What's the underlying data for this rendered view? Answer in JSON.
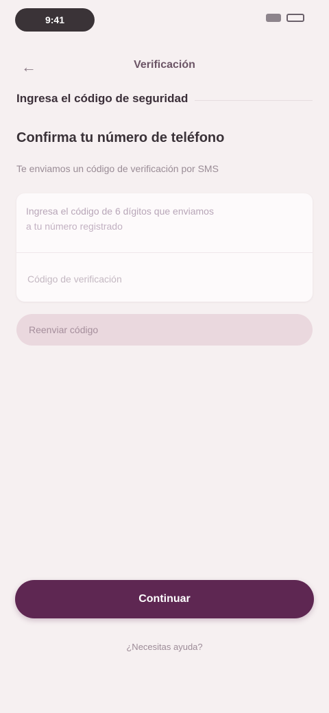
{
  "status_bar": {
    "time": "9:41"
  },
  "header": {
    "back_icon": "arrow-left-icon",
    "title": "Verificación"
  },
  "section": {
    "heading": "Ingresa el código de seguridad"
  },
  "content": {
    "title": "Confirma tu número de teléfono",
    "subtitle": "Te enviamos un código de verificación por SMS"
  },
  "card": {
    "label_line_1": "Ingresa el código de 6 dígitos que enviamos",
    "label_line_2": "a tu número registrado",
    "input_placeholder": "Código de verificación",
    "input_value": ""
  },
  "secondary_action": {
    "label": "Reenviar código"
  },
  "primary_action": {
    "label": "Continuar"
  },
  "footer": {
    "link": "¿Necesitas ayuda?"
  },
  "colors": {
    "background": "#f6f0f1",
    "primary": "#5e2752",
    "secondary": "#ead8de"
  }
}
